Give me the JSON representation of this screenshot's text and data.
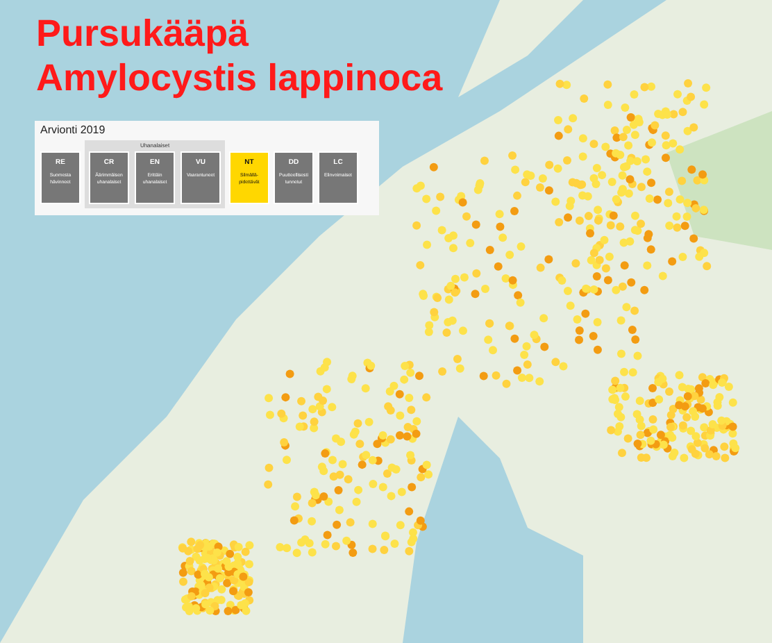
{
  "title": {
    "finnish_name": "Pursukääpä",
    "latin_name": "Amylocystis lappinoca"
  },
  "assessment": {
    "heading": "Arvionti 2019",
    "group_label": "Uhanalaiset",
    "categories": [
      {
        "code": "RE",
        "label": "Suomesta hävinneet",
        "grouped": false,
        "selected": false
      },
      {
        "code": "CR",
        "label": "Äärimmäisen uhanalaiset",
        "grouped": true,
        "selected": false
      },
      {
        "code": "EN",
        "label": "Erittäin uhanalaiset",
        "grouped": true,
        "selected": false
      },
      {
        "code": "VU",
        "label": "Vaarantuneet",
        "grouped": true,
        "selected": false
      },
      {
        "code": "NT",
        "label": "Silmällä-pidettävät",
        "grouped": false,
        "selected": true
      },
      {
        "code": "DD",
        "label": "Puutteellisesti tunnetut",
        "grouped": false,
        "selected": false
      },
      {
        "code": "LC",
        "label": "Elinvoimaiset",
        "grouped": false,
        "selected": false
      }
    ]
  }
}
